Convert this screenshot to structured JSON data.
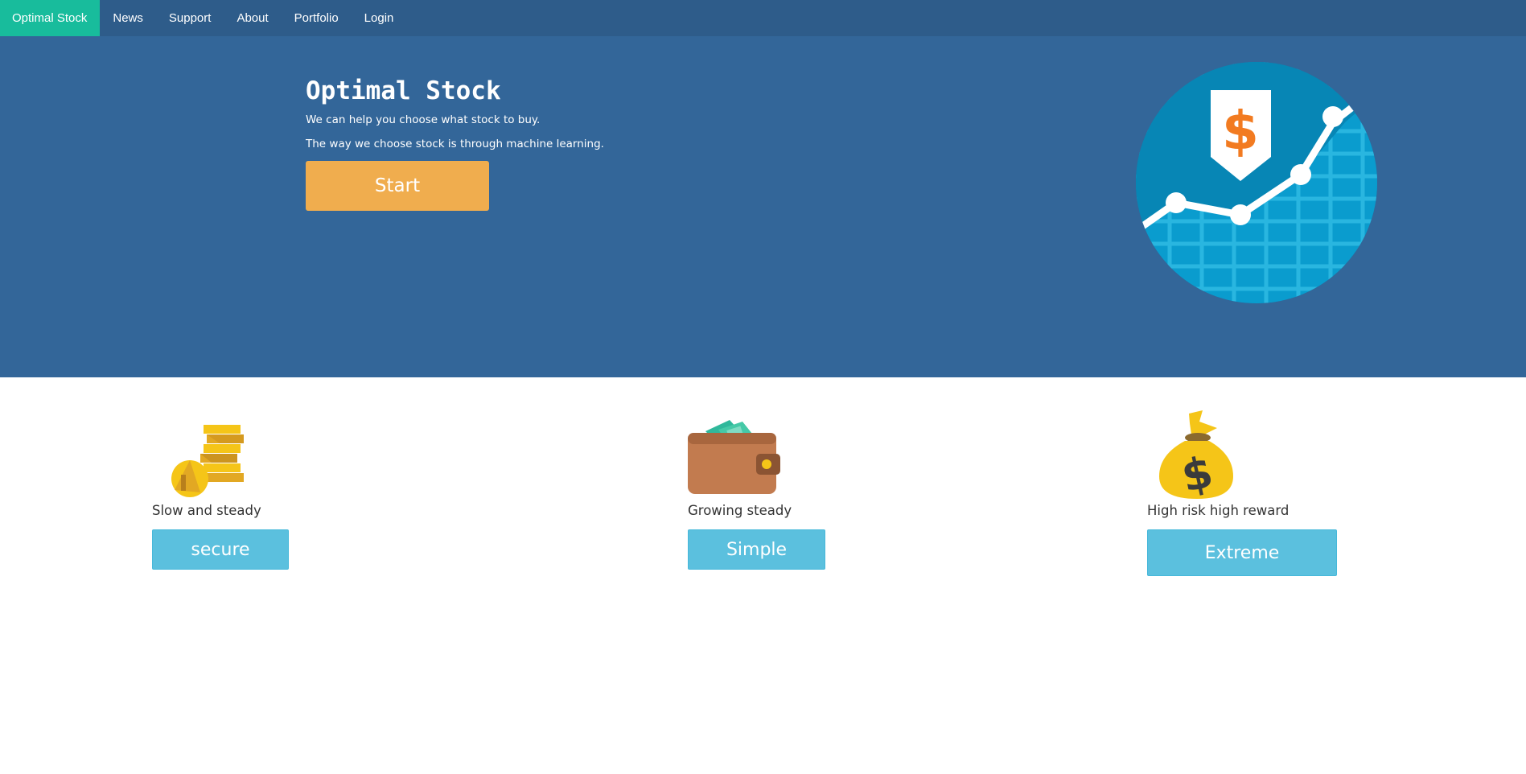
{
  "nav": {
    "brand": "Optimal Stock",
    "items": [
      {
        "label": "News"
      },
      {
        "label": "Support"
      },
      {
        "label": "About"
      },
      {
        "label": "Portfolio"
      },
      {
        "label": "Login"
      }
    ]
  },
  "hero": {
    "title": "Optimal Stock",
    "line1": "We can help you choose what stock to buy.",
    "line2": "The way we choose stock is through machine learning.",
    "start_label": "Start",
    "graphic_icon": "stock-growth-chart-icon"
  },
  "features": [
    {
      "icon": "coins-stack-icon",
      "label": "Slow and steady",
      "button": "secure"
    },
    {
      "icon": "wallet-icon",
      "label": "Growing steady",
      "button": "Simple"
    },
    {
      "icon": "money-bag-icon",
      "label": "High risk high reward",
      "button": "Extreme"
    }
  ],
  "colors": {
    "navbar": "#2e5c8a",
    "brand": "#18bc9c",
    "hero": "#336699",
    "start_button": "#f0ad4e",
    "info_button": "#5bc0de"
  }
}
